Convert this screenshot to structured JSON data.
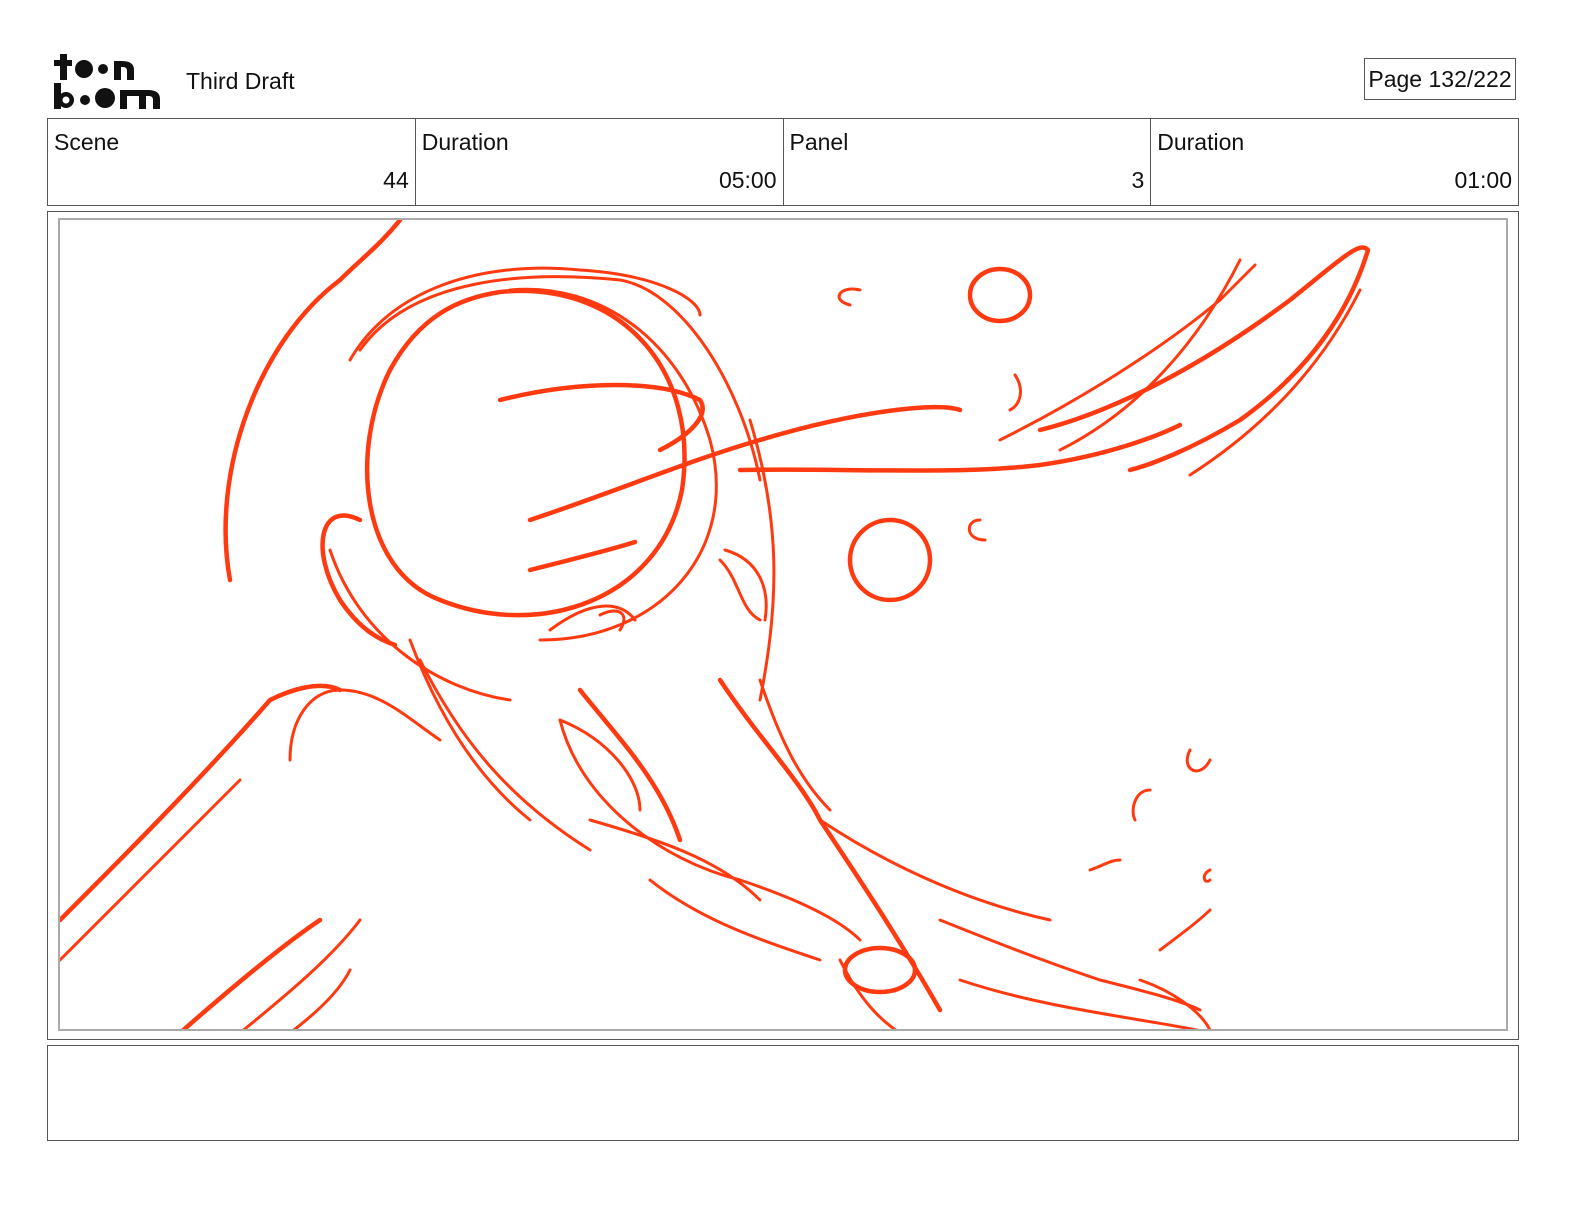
{
  "header": {
    "logo_text": "toon boom",
    "title": "Third Draft",
    "page_label": "Page 132/222"
  },
  "info": {
    "scene_label": "Scene",
    "scene_value": "44",
    "scene_duration_label": "Duration",
    "scene_duration_value": "05:00",
    "panel_label": "Panel",
    "panel_value": "3",
    "panel_duration_label": "Duration",
    "panel_duration_value": "01:00"
  },
  "sketch": {
    "stroke_color": "#ff3a10",
    "subject": "rough-sketch-figure"
  },
  "notes": {
    "text": ""
  }
}
